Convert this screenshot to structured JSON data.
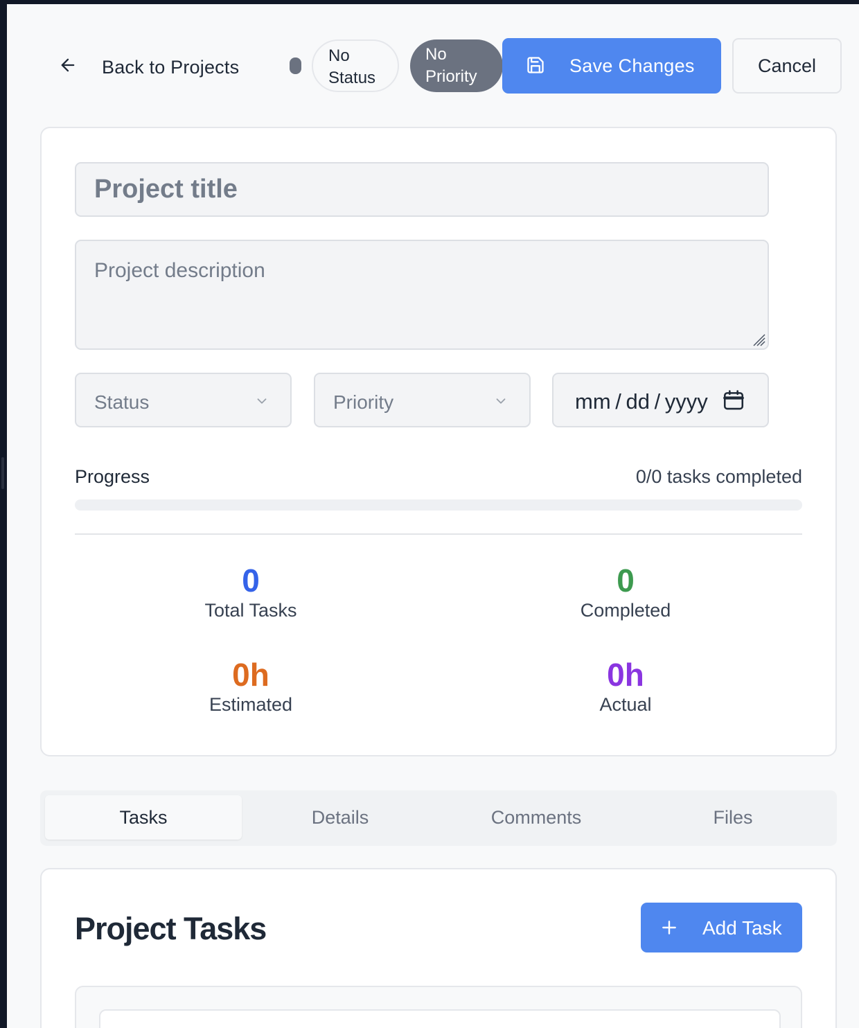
{
  "header": {
    "back_label": "Back to Projects",
    "status_badge": "No Status",
    "priority_badge": "No Priority",
    "save_label": "Save Changes",
    "cancel_label": "Cancel"
  },
  "form": {
    "title_value": "",
    "title_placeholder": "Project title",
    "description_value": "",
    "description_placeholder": "Project description",
    "status_select": "Status",
    "priority_select": "Priority",
    "date_placeholder": "mm / dd / yyyy"
  },
  "progress": {
    "label": "Progress",
    "count_text": "0/0 tasks completed",
    "fraction": 0
  },
  "stats": {
    "total": {
      "value": "0",
      "label": "Total Tasks",
      "color": "#3563e9"
    },
    "completed": {
      "value": "0",
      "label": "Completed",
      "color": "#3d9a4f"
    },
    "estimated": {
      "value": "0h",
      "label": "Estimated",
      "color": "#dd6b20"
    },
    "actual": {
      "value": "0h",
      "label": "Actual",
      "color": "#8a35e0"
    }
  },
  "tabs": [
    {
      "label": "Tasks",
      "active": true
    },
    {
      "label": "Details",
      "active": false
    },
    {
      "label": "Comments",
      "active": false
    },
    {
      "label": "Files",
      "active": false
    }
  ],
  "tasks_section": {
    "heading": "Project Tasks",
    "add_label": "Add Task"
  },
  "icons": {
    "back": "arrow-left-icon",
    "save": "floppy-disk-icon",
    "chevron": "chevron-down-icon",
    "calendar": "calendar-icon",
    "add": "plus-icon"
  },
  "colors": {
    "accent": "#4f87ef",
    "priority_badge_bg": "#6b7280"
  }
}
